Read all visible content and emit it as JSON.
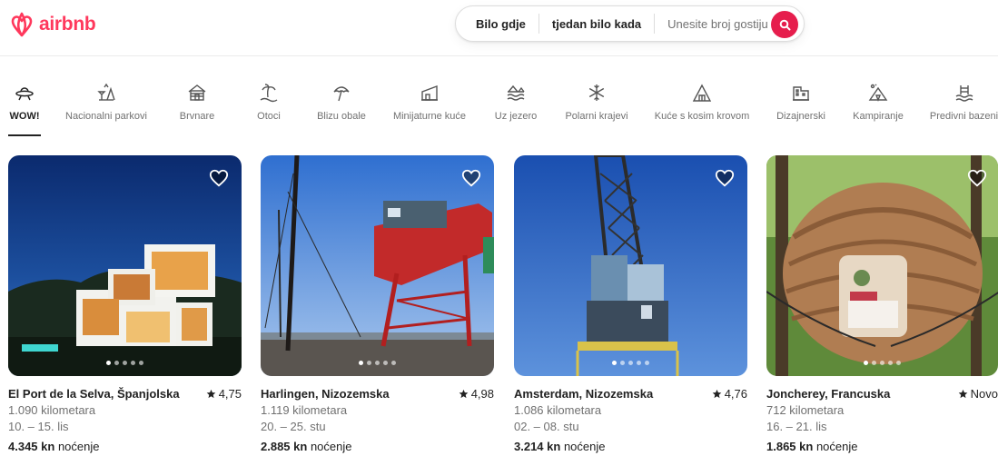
{
  "header": {
    "logo_text": "airbnb",
    "brand_color": "#ff385c",
    "search": {
      "location": "Bilo gdje",
      "dates": "tjedan bilo kada",
      "guests_placeholder": "Unesite broj gostiju",
      "button_color": "#e61e4d"
    }
  },
  "categories": [
    {
      "label": "WOW!",
      "icon": "ufo-icon",
      "active": true
    },
    {
      "label": "Nacionalni parkovi",
      "icon": "national-park-icon"
    },
    {
      "label": "Brvnare",
      "icon": "cabin-icon"
    },
    {
      "label": "Otoci",
      "icon": "island-icon"
    },
    {
      "label": "Blizu obale",
      "icon": "beach-umbrella-icon"
    },
    {
      "label": "Minijaturne kuće",
      "icon": "tiny-house-icon"
    },
    {
      "label": "Uz jezero",
      "icon": "lake-icon"
    },
    {
      "label": "Polarni krajevi",
      "icon": "snowflake-icon"
    },
    {
      "label": "Kuće s kosim krovom",
      "icon": "a-frame-icon"
    },
    {
      "label": "Dizajnerski",
      "icon": "design-building-icon"
    },
    {
      "label": "Kampiranje",
      "icon": "camping-icon"
    },
    {
      "label": "Predivni bazeni",
      "icon": "pool-icon"
    }
  ],
  "listings": [
    {
      "title": "El Port de la Selva, Španjolska",
      "rating": "4,75",
      "distance": "1.090 kilometara",
      "dates": "10. – 15. lis",
      "price": "4.345 kn",
      "price_suffix": "noćenje",
      "photo_count": 5,
      "photo_index": 1
    },
    {
      "title": "Harlingen, Nizozemska",
      "rating": "4,98",
      "distance": "1.119 kilometara",
      "dates": "20. – 25. stu",
      "price": "2.885 kn",
      "price_suffix": "noćenje",
      "photo_count": 5,
      "photo_index": 1
    },
    {
      "title": "Amsterdam, Nizozemska",
      "rating": "4,76",
      "distance": "1.086 kilometara",
      "dates": "02. – 08. stu",
      "price": "3.214 kn",
      "price_suffix": "noćenje",
      "photo_count": 5,
      "photo_index": 1
    },
    {
      "title": "Joncherey, Francuska",
      "rating": "Novo",
      "distance": "712 kilometara",
      "dates": "16. – 21. lis",
      "price": "1.865 kn",
      "price_suffix": "noćenje",
      "photo_count": 5,
      "photo_index": 1
    }
  ]
}
